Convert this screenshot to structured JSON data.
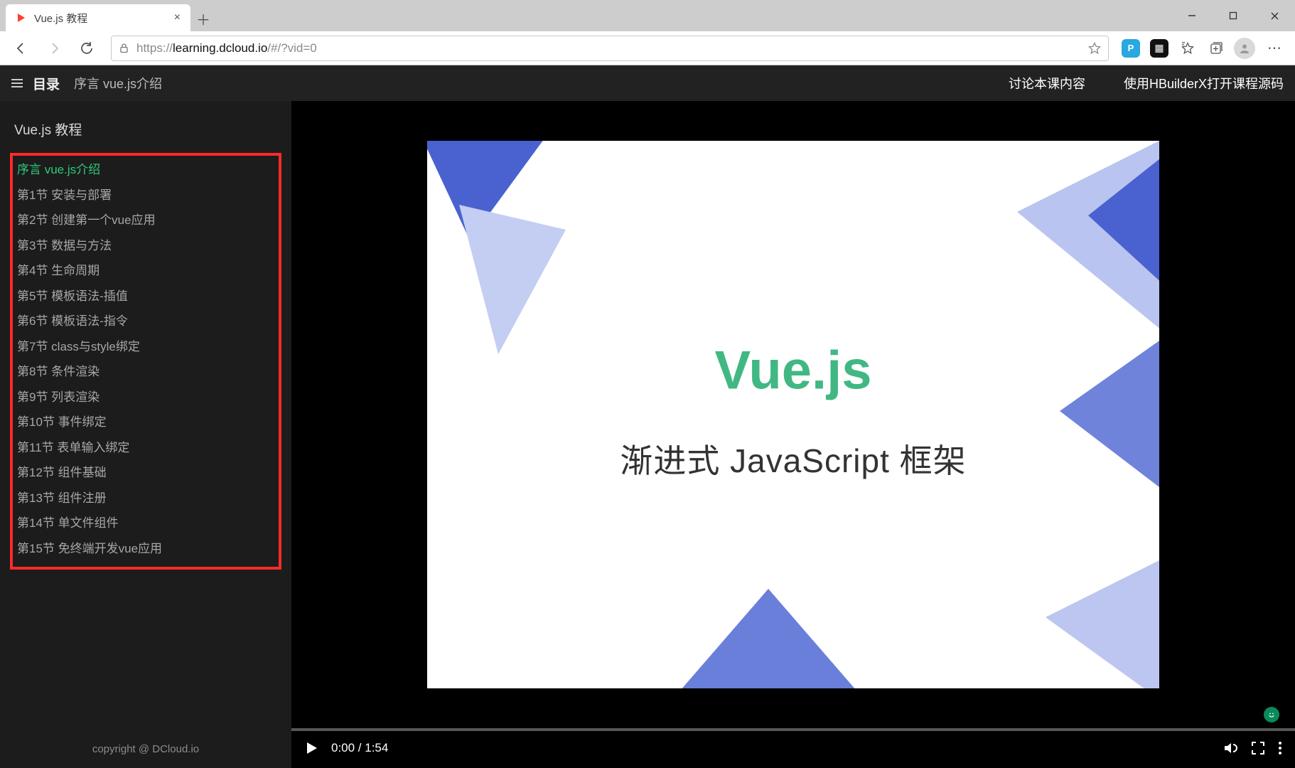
{
  "browser": {
    "tab_title": "Vue.js 教程",
    "url_host": "learning.dcloud.io",
    "url_scheme": "https://",
    "url_path": "/#/?vid=0"
  },
  "header": {
    "toc_label": "目录",
    "breadcrumb": "序言 vue.js介绍",
    "discuss": "讨论本课内容",
    "open_source": "使用HBuilderX打开课程源码"
  },
  "sidebar": {
    "title": "Vue.js 教程",
    "items": [
      "序言 vue.js介绍",
      "第1节 安装与部署",
      "第2节 创建第一个vue应用",
      "第3节 数据与方法",
      "第4节 生命周期",
      "第5节 模板语法-插值",
      "第6节 模板语法-指令",
      "第7节 class与style绑定",
      "第8节 条件渲染",
      "第9节 列表渲染",
      "第10节 事件绑定",
      "第11节 表单输入绑定",
      "第12节 组件基础",
      "第13节 组件注册",
      "第14节 单文件组件",
      "第15节 免终端开发vue应用"
    ],
    "active_index": 0,
    "copyright": "copyright @ DCloud.io"
  },
  "slide": {
    "title": "Vue.js",
    "subtitle": "渐进式 JavaScript 框架"
  },
  "player": {
    "time": "0:00 / 1:54"
  }
}
